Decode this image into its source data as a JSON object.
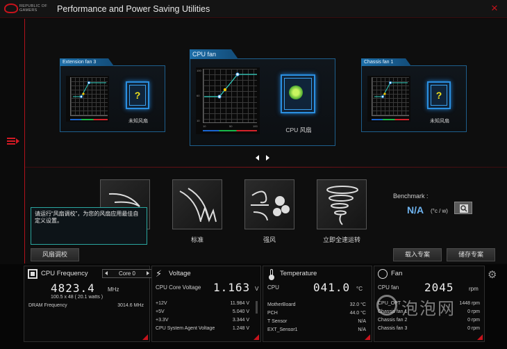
{
  "app": {
    "logo_text": "REPUBLIC OF GAMERS",
    "title": "Performance and Power Saving Utilities",
    "close_glyph": "×"
  },
  "fans": {
    "ext3": {
      "tab": "Extension fan 3",
      "label": "未知风扇"
    },
    "cpu": {
      "tab": "CPU fan",
      "label": "CPU 风扇"
    },
    "chassis1": {
      "tab": "Chassis fan 1",
      "label": "未知风扇"
    },
    "y_ticks": [
      "100",
      "90",
      "80",
      "70",
      "60",
      "50",
      "40",
      "30",
      "20",
      "10"
    ],
    "x_ticks": [
      "10",
      "20",
      "30",
      "40",
      "50",
      "60",
      "70",
      "80",
      "90",
      "100"
    ],
    "x_unit": "°C",
    "y_unit": "%"
  },
  "modes": {
    "standard": "标准",
    "turbo": "强风",
    "full": "立即全速运转"
  },
  "tooltip": "请运行“风扇调校”，为您的风扇应用最佳自定义设置。",
  "benchmark": {
    "label": "Benchmark :",
    "value": "N/A",
    "unit": "(°c / w)"
  },
  "buttons": {
    "fan_tune": "风扇调校",
    "load_profile": "载入专案",
    "save_profile": "储存专案"
  },
  "cpu_freq": {
    "title": "CPU Frequency",
    "core_select": "Core 0",
    "value": "4823.4",
    "unit": "MHz",
    "detail": "100.5  x  48    ( 20.1 watts )",
    "dram_label": "DRAM Frequency",
    "dram_value": "3014.6  MHz"
  },
  "voltage": {
    "title": "Voltage",
    "core_label": "CPU Core Voltage",
    "core_value": "1.163",
    "core_unit": "V",
    "rows": [
      {
        "label": "+12V",
        "value": "11.984  V"
      },
      {
        "label": "+5V",
        "value": "5.040  V"
      },
      {
        "label": "+3.3V",
        "value": "3.344  V"
      },
      {
        "label": "CPU System Agent Voltage",
        "value": "1.248  V"
      }
    ]
  },
  "temperature": {
    "title": "Temperature",
    "cpu_label": "CPU",
    "cpu_value": "041.0",
    "cpu_unit": "°C",
    "rows": [
      {
        "label": "MotherBoard",
        "value": "32.0 °C"
      },
      {
        "label": "PCH",
        "value": "44.0 °C"
      },
      {
        "label": "T Sensor",
        "value": "N/A"
      },
      {
        "label": "EXT_Sensor1",
        "value": "N/A"
      }
    ]
  },
  "fan_status": {
    "title": "Fan",
    "cpu_label": "CPU fan",
    "cpu_value": "2045",
    "cpu_unit": "rpm",
    "rows": [
      {
        "label": "CPU_OPT",
        "value": "1448 rpm"
      },
      {
        "label": "Chassis fan 1",
        "value": "0  rpm"
      },
      {
        "label": "Chassis fan 2",
        "value": "0  rpm"
      },
      {
        "label": "Chassis fan 3",
        "value": "0  rpm"
      }
    ]
  },
  "watermark": "泡泡网",
  "colors": {
    "accent_red": "#c8131c",
    "accent_blue": "#1d6ea8",
    "tooltip_border": "#2aa7a0"
  }
}
